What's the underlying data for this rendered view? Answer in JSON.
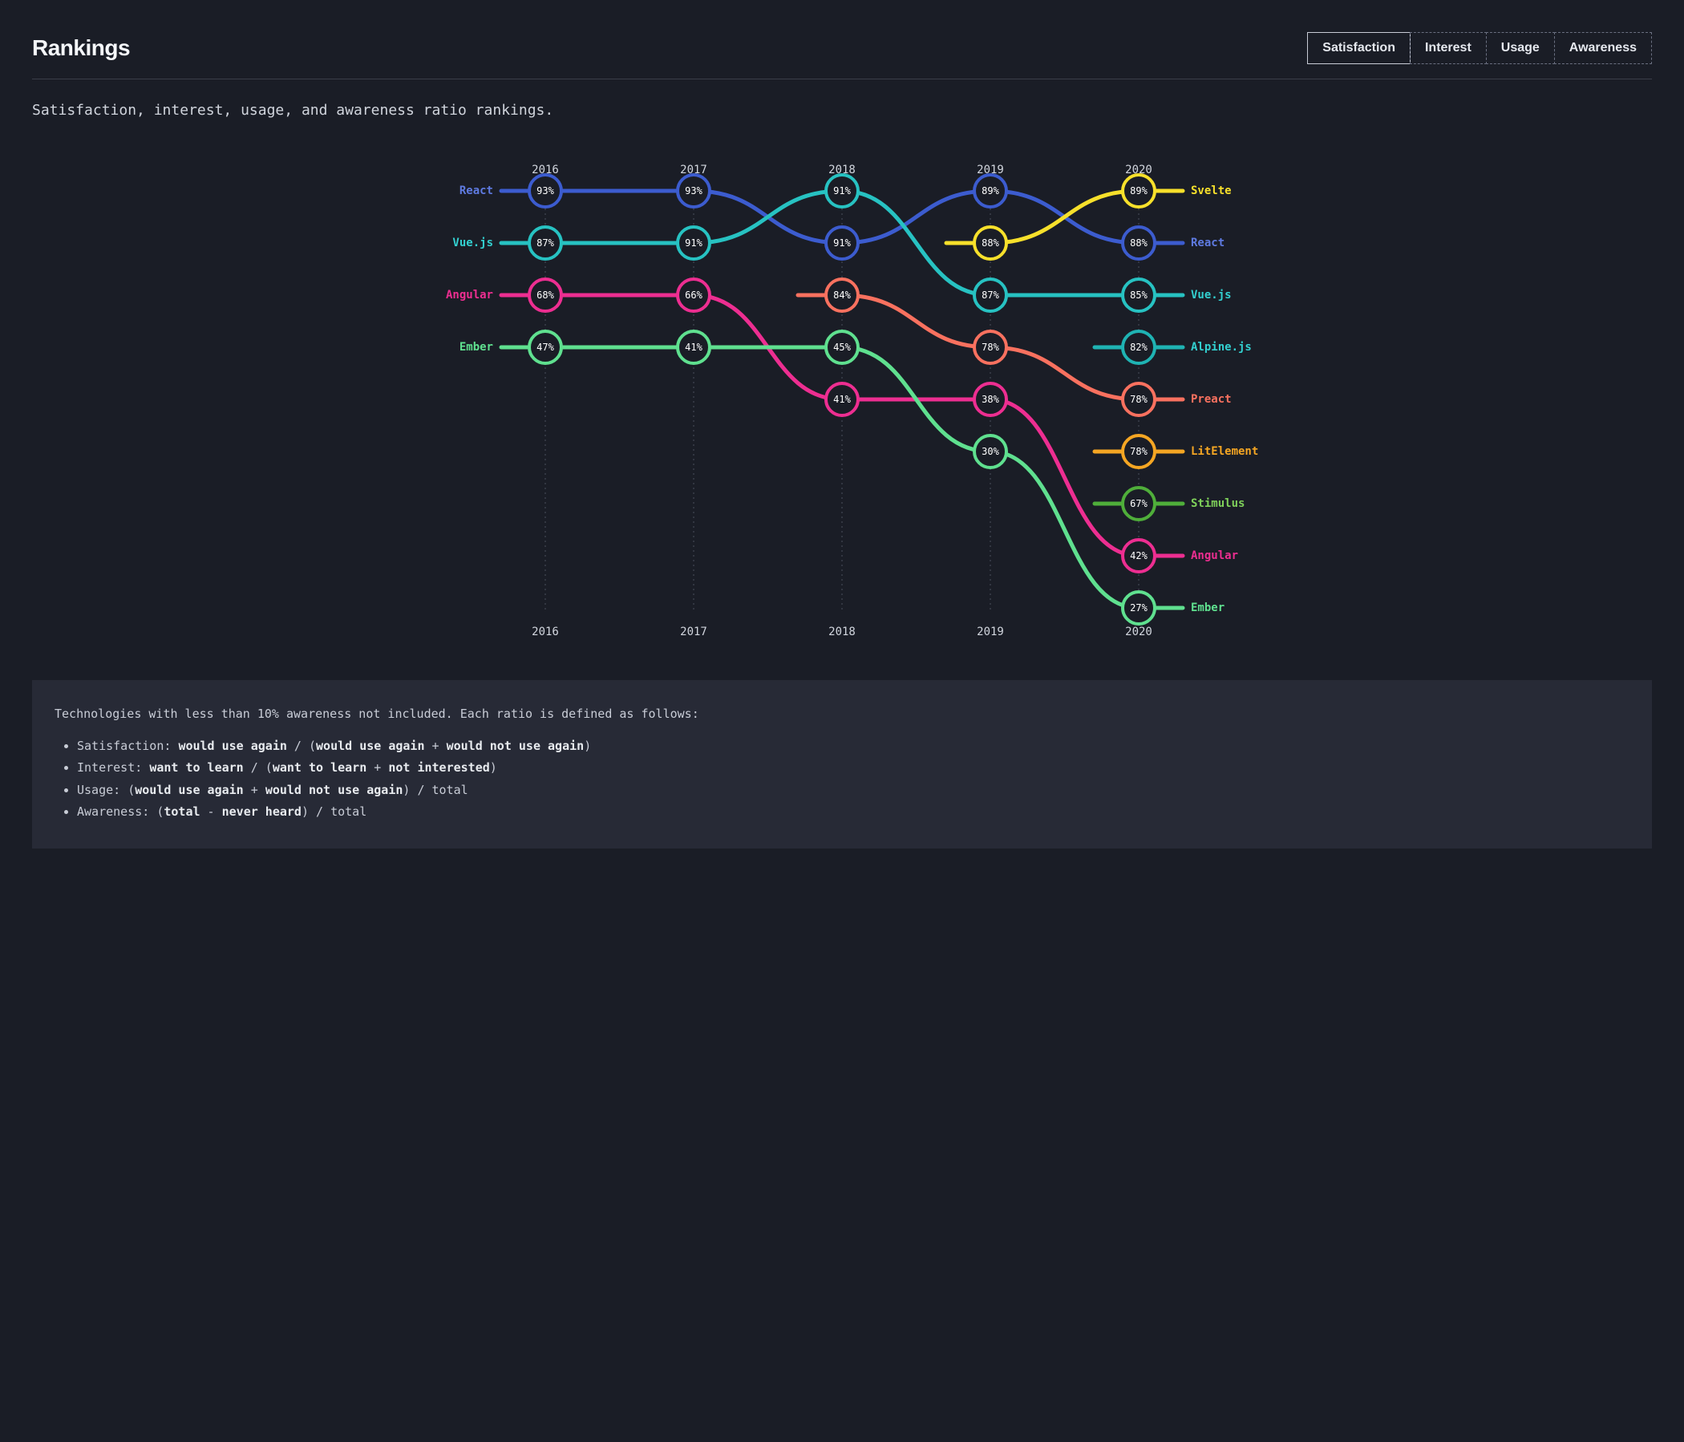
{
  "title": "Rankings",
  "tabs": [
    {
      "label": "Satisfaction",
      "active": true
    },
    {
      "label": "Interest",
      "active": false
    },
    {
      "label": "Usage",
      "active": false
    },
    {
      "label": "Awareness",
      "active": false
    }
  ],
  "subtitle": "Satisfaction, interest, usage, and awareness ratio rankings.",
  "note": {
    "intro": "Technologies with less than 10% awareness not included. Each ratio is defined as follows:",
    "items": [
      {
        "term": "Satisfaction",
        "def_html": "<strong>would use again</strong> / (<strong>would use again</strong> + <strong>would not use again</strong>)"
      },
      {
        "term": "Interest",
        "def_html": "<strong>want to learn</strong> / (<strong>want to learn</strong> + <strong>not interested</strong>)"
      },
      {
        "term": "Usage",
        "def_html": "(<strong>would use again</strong> + <strong>would not use again</strong>) / total"
      },
      {
        "term": "Awareness",
        "def_html": "(<strong>total</strong> - <strong>never heard</strong>) / total"
      }
    ]
  },
  "chart_data": {
    "type": "bump",
    "metric": "Satisfaction",
    "years": [
      "2016",
      "2017",
      "2018",
      "2019",
      "2020"
    ],
    "left_labels": [
      "React",
      "Vue.js",
      "Angular",
      "Ember"
    ],
    "right_labels": [
      "Svelte",
      "React",
      "Vue.js",
      "Alpine.js",
      "Preact",
      "LitElement",
      "Stimulus",
      "Angular",
      "Ember"
    ],
    "series": [
      {
        "name": "React",
        "color": "#3c5ccf",
        "points": [
          {
            "year": "2016",
            "rank": 1,
            "value": 93
          },
          {
            "year": "2017",
            "rank": 1,
            "value": 93
          },
          {
            "year": "2018",
            "rank": 2,
            "value": 91
          },
          {
            "year": "2019",
            "rank": 1,
            "value": 89
          },
          {
            "year": "2020",
            "rank": 2,
            "value": 88
          }
        ]
      },
      {
        "name": "Vue.js",
        "color": "#27c2c2",
        "points": [
          {
            "year": "2016",
            "rank": 2,
            "value": 87
          },
          {
            "year": "2017",
            "rank": 2,
            "value": 91
          },
          {
            "year": "2018",
            "rank": 1,
            "value": 91
          },
          {
            "year": "2019",
            "rank": 3,
            "value": 87
          },
          {
            "year": "2020",
            "rank": 3,
            "value": 85
          }
        ]
      },
      {
        "name": "Angular",
        "color": "#ed2e91",
        "points": [
          {
            "year": "2016",
            "rank": 3,
            "value": 68
          },
          {
            "year": "2017",
            "rank": 3,
            "value": 66
          },
          {
            "year": "2018",
            "rank": 5,
            "value": 41
          },
          {
            "year": "2019",
            "rank": 5,
            "value": 38
          },
          {
            "year": "2020",
            "rank": 8,
            "value": 42
          }
        ]
      },
      {
        "name": "Ember",
        "color": "#5fe08f",
        "points": [
          {
            "year": "2016",
            "rank": 4,
            "value": 47
          },
          {
            "year": "2017",
            "rank": 4,
            "value": 41
          },
          {
            "year": "2018",
            "rank": 4,
            "value": 45
          },
          {
            "year": "2019",
            "rank": 6,
            "value": 30
          },
          {
            "year": "2020",
            "rank": 9,
            "value": 27
          }
        ]
      },
      {
        "name": "Preact",
        "color": "#f9715f",
        "points": [
          {
            "year": "2018",
            "rank": 3,
            "value": 84
          },
          {
            "year": "2019",
            "rank": 4,
            "value": 78
          },
          {
            "year": "2020",
            "rank": 5,
            "value": 78
          }
        ]
      },
      {
        "name": "Svelte",
        "color": "#f7e02b",
        "points": [
          {
            "year": "2019",
            "rank": 2,
            "value": 88
          },
          {
            "year": "2020",
            "rank": 1,
            "value": 89
          }
        ]
      },
      {
        "name": "Alpine.js",
        "color": "#1fb3b3",
        "points": [
          {
            "year": "2020",
            "rank": 4,
            "value": 82
          }
        ]
      },
      {
        "name": "LitElement",
        "color": "#f5a623",
        "points": [
          {
            "year": "2020",
            "rank": 6,
            "value": 78
          }
        ]
      },
      {
        "name": "Stimulus",
        "color": "#4fae3a",
        "points": [
          {
            "year": "2020",
            "rank": 7,
            "value": 67
          }
        ]
      }
    ],
    "label_colors": {
      "React": "#5e7ae0",
      "Vue.js": "#33d0d0",
      "Angular": "#ed2e91",
      "Ember": "#5fe08f",
      "Svelte": "#f7e02b",
      "Alpine.js": "#33d0d0",
      "Preact": "#f9715f",
      "LitElement": "#f5a623",
      "Stimulus": "#7fd15a"
    }
  }
}
